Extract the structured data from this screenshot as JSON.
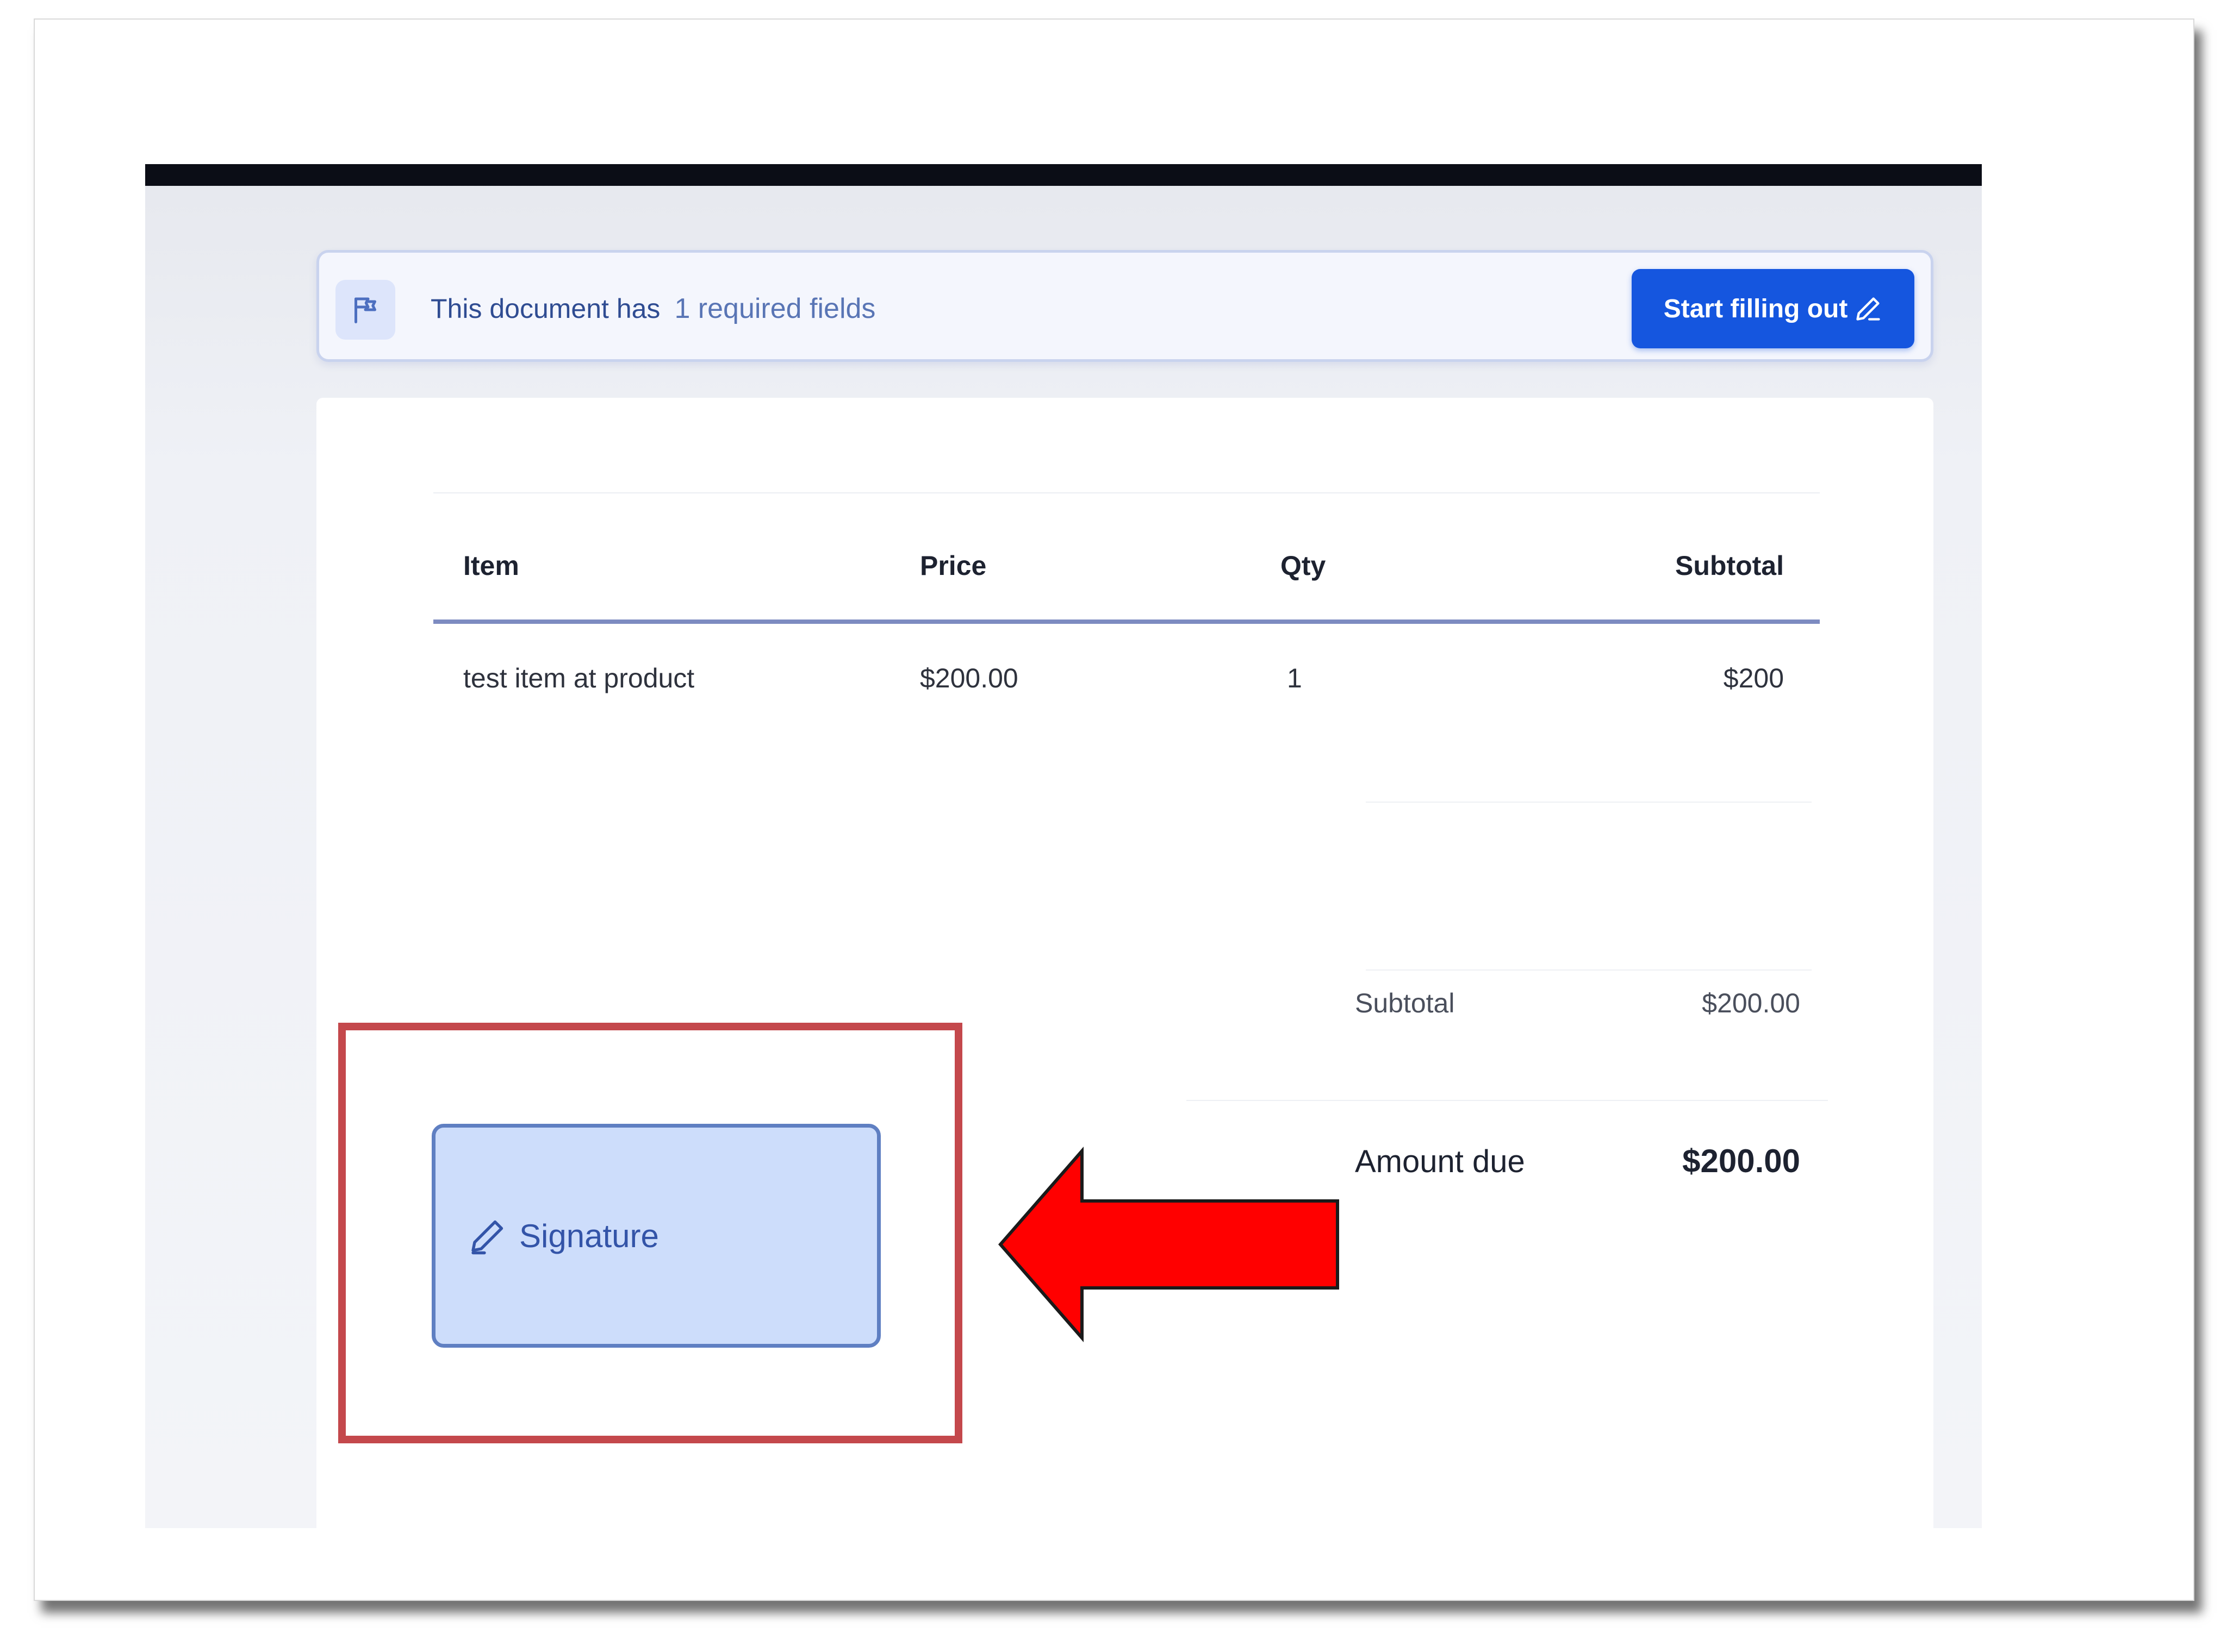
{
  "banner": {
    "message": "This document has",
    "count_text": "1 required fields",
    "start_button_label": "Start filling out"
  },
  "table": {
    "headers": [
      "Item",
      "Price",
      "Qty",
      "Subtotal"
    ],
    "rows": [
      [
        "test item at product",
        "$200.00",
        "1",
        "$200"
      ]
    ]
  },
  "summary": {
    "subtotal_label": "Subtotal",
    "subtotal_value": "$200.00",
    "amount_due_label": "Amount due",
    "amount_due_value": "$200.00"
  },
  "signature": {
    "label": "Signature"
  },
  "colors": {
    "primary_button": "#1556df",
    "highlight_border": "#c4484c",
    "arrow": "#ff0000",
    "signature_field_bg": "#cdddfb"
  },
  "icons": {
    "banner": "flag-icon",
    "start_button": "pencil-icon",
    "signature": "pencil-icon"
  }
}
